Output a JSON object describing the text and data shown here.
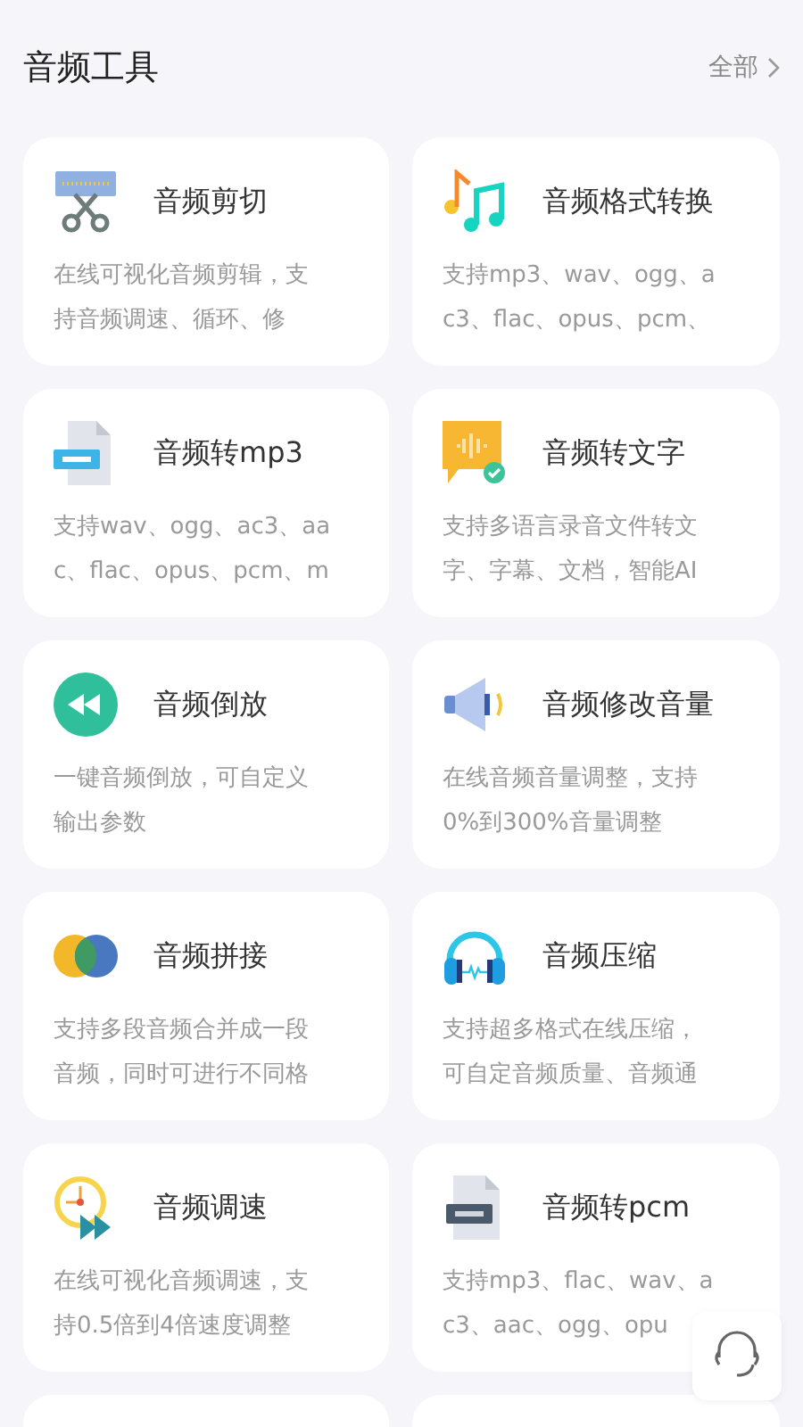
{
  "header": {
    "title": "音频工具",
    "more": "全部"
  },
  "tools": [
    {
      "kind": "scissors",
      "title": "音频剪切",
      "lines": [
        "在线可视化音频剪辑，支",
        "持音频调速、循环、修"
      ]
    },
    {
      "kind": "notes",
      "title": "音频格式转换",
      "lines": [
        "支持mp3、wav、ogg、a",
        "c3、flac、opus、pcm、"
      ]
    },
    {
      "kind": "mp3",
      "title": "音频转mp3",
      "lines": [
        "支持wav、ogg、ac3、aa",
        "c、flac、opus、pcm、m"
      ]
    },
    {
      "kind": "speech",
      "title": "音频转文字",
      "lines": [
        "支持多语言录音文件转文",
        "字、字幕、文档，智能AI"
      ]
    },
    {
      "kind": "rewind",
      "title": "音频倒放",
      "lines": [
        "一键音频倒放，可自定义",
        "输出参数"
      ]
    },
    {
      "kind": "speaker",
      "title": "音频修改音量",
      "lines": [
        "在线音频音量调整，支持",
        "0%到300%音量调整"
      ]
    },
    {
      "kind": "circles",
      "title": "音频拼接",
      "lines": [
        "支持多段音频合并成一段",
        "音频，同时可进行不同格"
      ]
    },
    {
      "kind": "headphones",
      "title": "音频压缩",
      "lines": [
        "支持超多格式在线压缩，",
        "可自定音频质量、音频通"
      ]
    },
    {
      "kind": "clock",
      "title": "音频调速",
      "lines": [
        "在线可视化音频调速，支",
        "持0.5倍到4倍速度调整"
      ]
    },
    {
      "kind": "pcm",
      "title": "音频转pcm",
      "lines": [
        "支持mp3、flac、wav、a",
        "c3、aac、ogg、opu"
      ]
    }
  ]
}
